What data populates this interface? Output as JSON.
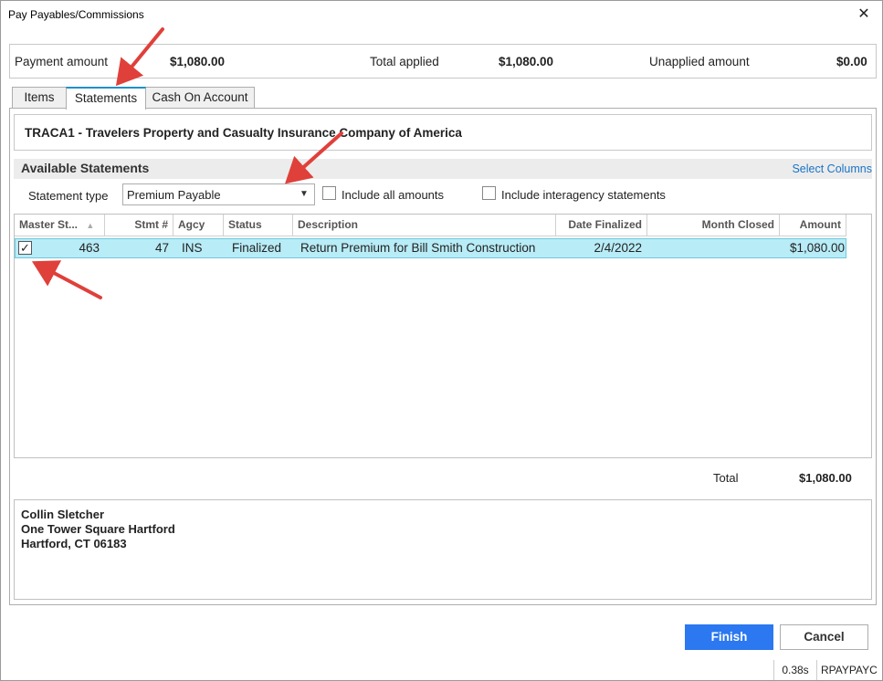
{
  "window": {
    "title": "Pay Payables/Commissions",
    "close_glyph": "✕"
  },
  "payment": {
    "payment_amount_label": "Payment amount",
    "payment_amount": "$1,080.00",
    "total_applied_label": "Total applied",
    "total_applied": "$1,080.00",
    "unapplied_label": "Unapplied amount",
    "unapplied": "$0.00"
  },
  "tabs": [
    {
      "label": "Items",
      "active": false
    },
    {
      "label": "Statements",
      "active": true
    },
    {
      "label": "Cash On Account",
      "active": false
    }
  ],
  "statements": {
    "company": "TRACA1 - Travelers Property and Casualty Insurance Company of America",
    "section_title": "Available Statements",
    "select_columns": "Select Columns",
    "statement_type_label": "Statement type",
    "statement_type_value": "Premium Payable",
    "include_all_amounts": "Include all amounts",
    "include_interagency": "Include interagency statements",
    "columns": [
      "Master St...",
      "Stmt #",
      "Agcy",
      "Status",
      "Description",
      "Date Finalized",
      "Month Closed",
      "Amount"
    ],
    "rows": [
      {
        "selected": true,
        "master": "463",
        "stmt": "47",
        "agcy": "INS",
        "status": "Finalized",
        "description": "Return Premium for Bill Smith Construction",
        "date_finalized": "2/4/2022",
        "month_closed": "",
        "amount": "$1,080.00"
      }
    ],
    "total_label": "Total",
    "total_value": "$1,080.00"
  },
  "address": {
    "line1": "Collin Sletcher",
    "line2": "One Tower Square Hartford",
    "line3": "Hartford, CT  06183"
  },
  "buttons": {
    "finish": "Finish",
    "cancel": "Cancel"
  },
  "status_bar": {
    "time": "0.38s",
    "code": "RPAYPAYC"
  },
  "colors": {
    "accent": "#2b78f0",
    "selected_row": "#b8ecf7",
    "annotation_arrow": "#e0403a"
  }
}
